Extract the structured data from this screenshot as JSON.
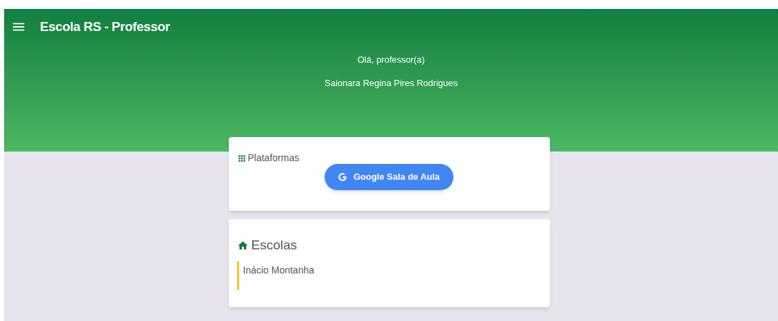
{
  "app_bar": {
    "title": "Escola RS - Professor"
  },
  "greeting": {
    "line_1": "Olá, professor(a)",
    "line_2": "Saionara Regina Pires Rodrigues"
  },
  "platforms_card": {
    "title": "Plataformas",
    "buttons": [
      "Google Sala de Aula"
    ]
  },
  "schools_card": {
    "title": "Escolas",
    "items": [
      {
        "name": "Inácio Montanha",
        "color": "#f5c518"
      }
    ]
  }
}
